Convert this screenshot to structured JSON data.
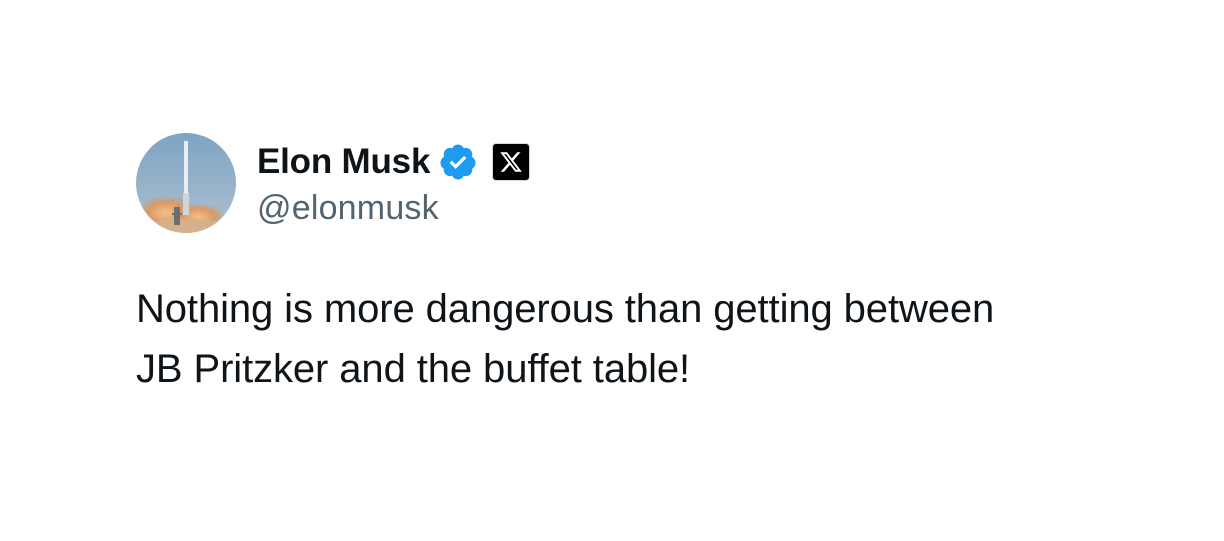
{
  "tweet": {
    "author": {
      "display_name": "Elon Musk",
      "handle": "@elonmusk",
      "verified": true,
      "verified_icon": "verified-badge-icon",
      "platform_icon": "x-logo-icon",
      "avatar": "rocket-launch-avatar"
    },
    "text": "Nothing is more dangerous than getting between\nJB Pritzker and the buffet table!"
  },
  "colors": {
    "background": "#ffffff",
    "text_primary": "#0f1419",
    "text_secondary": "#536471",
    "verified_blue": "#1d9bf0"
  }
}
